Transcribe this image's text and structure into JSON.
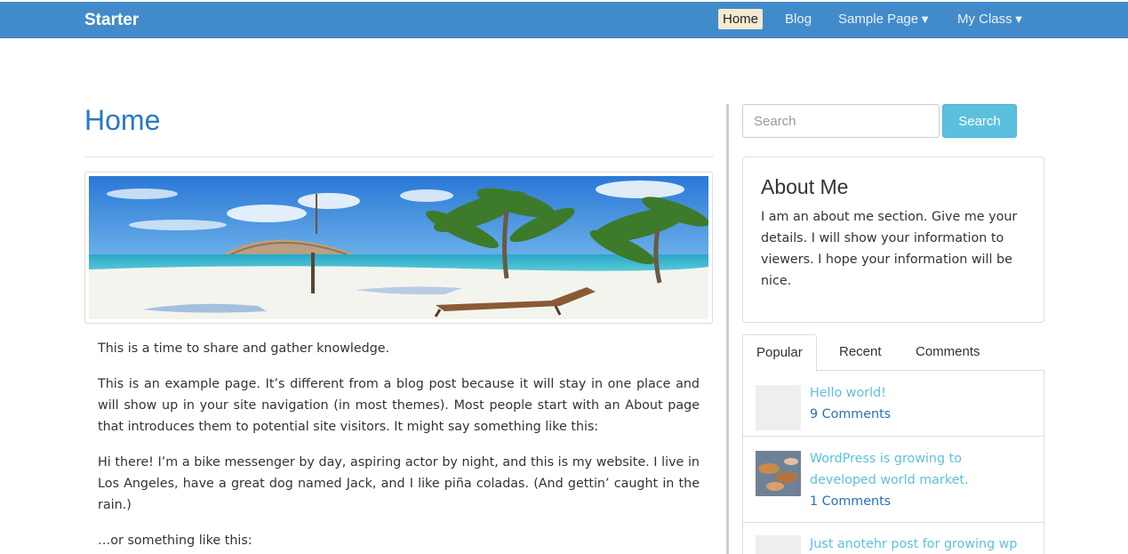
{
  "navbar": {
    "brand": "Starter",
    "items": [
      {
        "label": "Home",
        "active": true,
        "dropdown": false
      },
      {
        "label": "Blog",
        "active": false,
        "dropdown": false
      },
      {
        "label": "Sample Page",
        "active": false,
        "dropdown": true
      },
      {
        "label": "My Class",
        "active": false,
        "dropdown": true
      }
    ],
    "caret": "▼"
  },
  "main": {
    "title": "Home",
    "paragraphs": [
      "This is a time to share and gather knowledge.",
      "This is an example page. It’s different from a blog post because it will stay in one place and will show up in your site navigation (in most themes). Most people start with an About page that introduces them to potential site visitors. It might say something like this:",
      "Hi there! I’m a bike messenger by day, aspiring actor by night, and this is my website. I live in Los Angeles, have a great dog named Jack, and I like piña coladas. (And gettin’ caught in the rain.)",
      "…or something like this:"
    ]
  },
  "sidebar": {
    "search": {
      "placeholder": "Search",
      "button": "Search"
    },
    "about": {
      "title": "About Me",
      "text": "I am an about me section. Give me your details. I will show your information to viewers. I hope your information will be nice."
    },
    "tabs": [
      "Popular",
      "Recent",
      "Comments"
    ],
    "posts": [
      {
        "title": "Hello world!",
        "comments": "9 Comments"
      },
      {
        "title": "WordPress is growing to developed world market.",
        "comments": "1 Comments"
      },
      {
        "title": "Just anotehr post for growing wp",
        "comments": ""
      }
    ]
  },
  "colors": {
    "navbar": "#428bca",
    "link": "#5bc0de",
    "title": "#2879c4",
    "button": "#5bc0de"
  }
}
